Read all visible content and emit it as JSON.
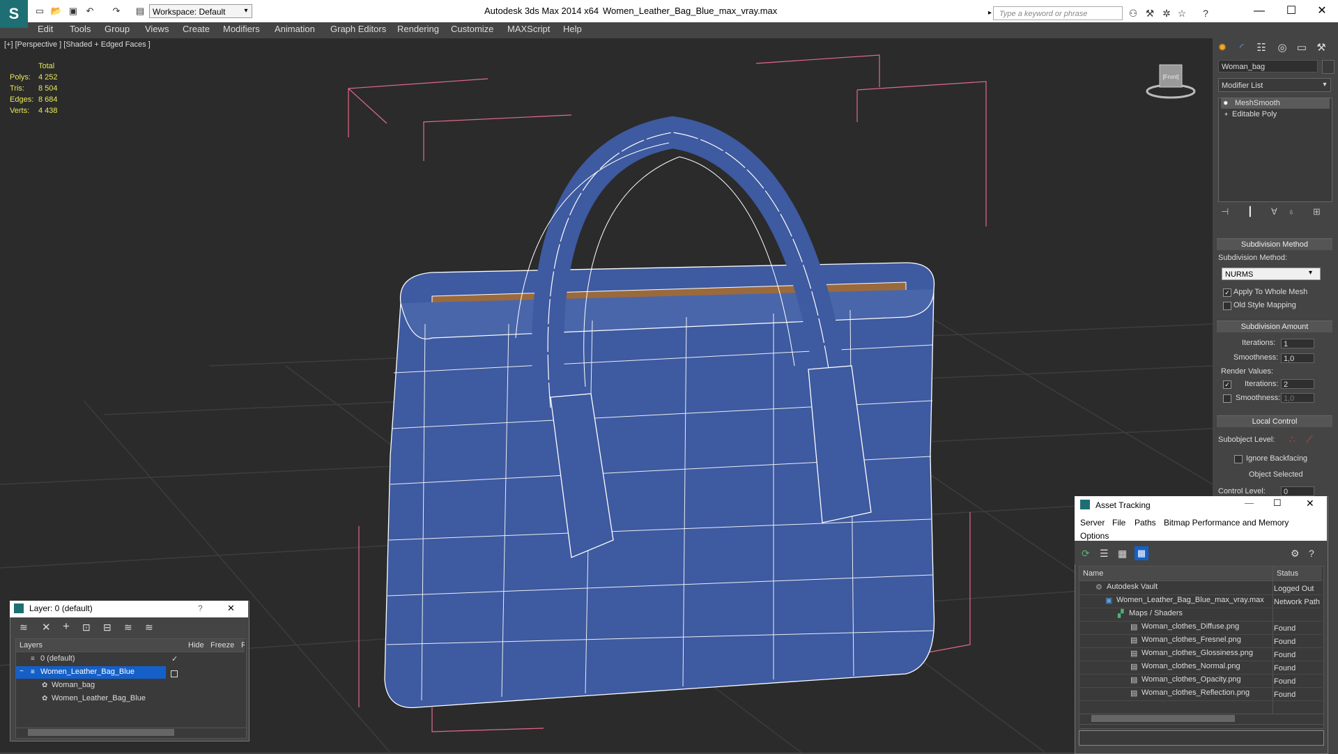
{
  "titlebar": {
    "workspace": "Workspace: Default",
    "app_title": "Autodesk 3ds Max  2014 x64",
    "file_name": "Women_Leather_Bag_Blue_max_vray.max",
    "search_placeholder": "Type a keyword or phrase"
  },
  "menu": [
    "Edit",
    "Tools",
    "Group",
    "Views",
    "Create",
    "Modifiers",
    "Animation",
    "Graph Editors",
    "Rendering",
    "Customize",
    "MAXScript",
    "Help"
  ],
  "viewport": {
    "label": "[+] [Perspective ] [Shaded + Edged Faces ]",
    "stats": {
      "header": "Total",
      "rows": [
        {
          "label": "Polys:",
          "value": "4 252"
        },
        {
          "label": "Tris:",
          "value": "8 504"
        },
        {
          "label": "Edges:",
          "value": "8 684"
        },
        {
          "label": "Verts:",
          "value": "4 438"
        }
      ]
    },
    "viewcube_label": "[Front]"
  },
  "command_panel": {
    "object_name": "Woman_bag",
    "modifier_list": "Modifier List",
    "stack": [
      "MeshSmooth",
      "Editable Poly"
    ],
    "subdivision_method": {
      "title": "Subdivision Method",
      "label": "Subdivision Method:",
      "value": "NURMS",
      "apply_whole": "Apply To Whole Mesh",
      "old_style": "Old Style Mapping"
    },
    "subdivision_amount": {
      "title": "Subdivision Amount",
      "iterations_label": "Iterations:",
      "iterations": "1",
      "smoothness_label": "Smoothness:",
      "smoothness": "1,0",
      "render_values": "Render Values:",
      "r_iterations_label": "Iterations:",
      "r_iterations": "2",
      "r_smoothness_label": "Smoothness:",
      "r_smoothness": "1,0"
    },
    "local_control": {
      "title": "Local Control",
      "subobject": "Subobject Level:",
      "ignore_backfacing": "Ignore Backfacing",
      "object_selected": "Object Selected",
      "control_level_label": "Control Level:",
      "control_level": "0"
    }
  },
  "layer_window": {
    "title": "Layer: 0 (default)",
    "help": "?",
    "close": "✕",
    "columns": [
      "Layers",
      "Hide",
      "Freeze",
      "R"
    ],
    "rows": [
      {
        "name": "0 (default)",
        "check": "✓"
      },
      {
        "name": "Women_Leather_Bag_Blue",
        "check": ""
      },
      {
        "name": "Woman_bag",
        "check": ""
      },
      {
        "name": "Women_Leather_Bag_Blue",
        "check": ""
      }
    ]
  },
  "asset_tracking": {
    "title": "Asset Tracking",
    "menu_row1": [
      "Server",
      "File",
      "Paths",
      "Bitmap Performance and Memory"
    ],
    "menu_row2": [
      "Options"
    ],
    "columns": [
      "Name",
      "Status"
    ],
    "rows": [
      {
        "name": "Autodesk Vault",
        "status": "Logged Out"
      },
      {
        "name": "Women_Leather_Bag_Blue_max_vray.max",
        "status": "Network Path"
      },
      {
        "name": "Maps / Shaders",
        "status": ""
      },
      {
        "name": "Woman_clothes_Diffuse.png",
        "status": "Found"
      },
      {
        "name": "Woman_clothes_Fresnel.png",
        "status": "Found"
      },
      {
        "name": "Woman_clothes_Glossiness.png",
        "status": "Found"
      },
      {
        "name": "Woman_clothes_Normal.png",
        "status": "Found"
      },
      {
        "name": "Woman_clothes_Opacity.png",
        "status": "Found"
      },
      {
        "name": "Woman_clothes_Reflection.png",
        "status": "Found"
      }
    ]
  },
  "colors": {
    "accent": "#1d6f73",
    "selection": "#1560c8",
    "stats": "#e8e85a",
    "bag_blue": "#3e5aa0",
    "bbox_pink": "#e46a8a"
  }
}
